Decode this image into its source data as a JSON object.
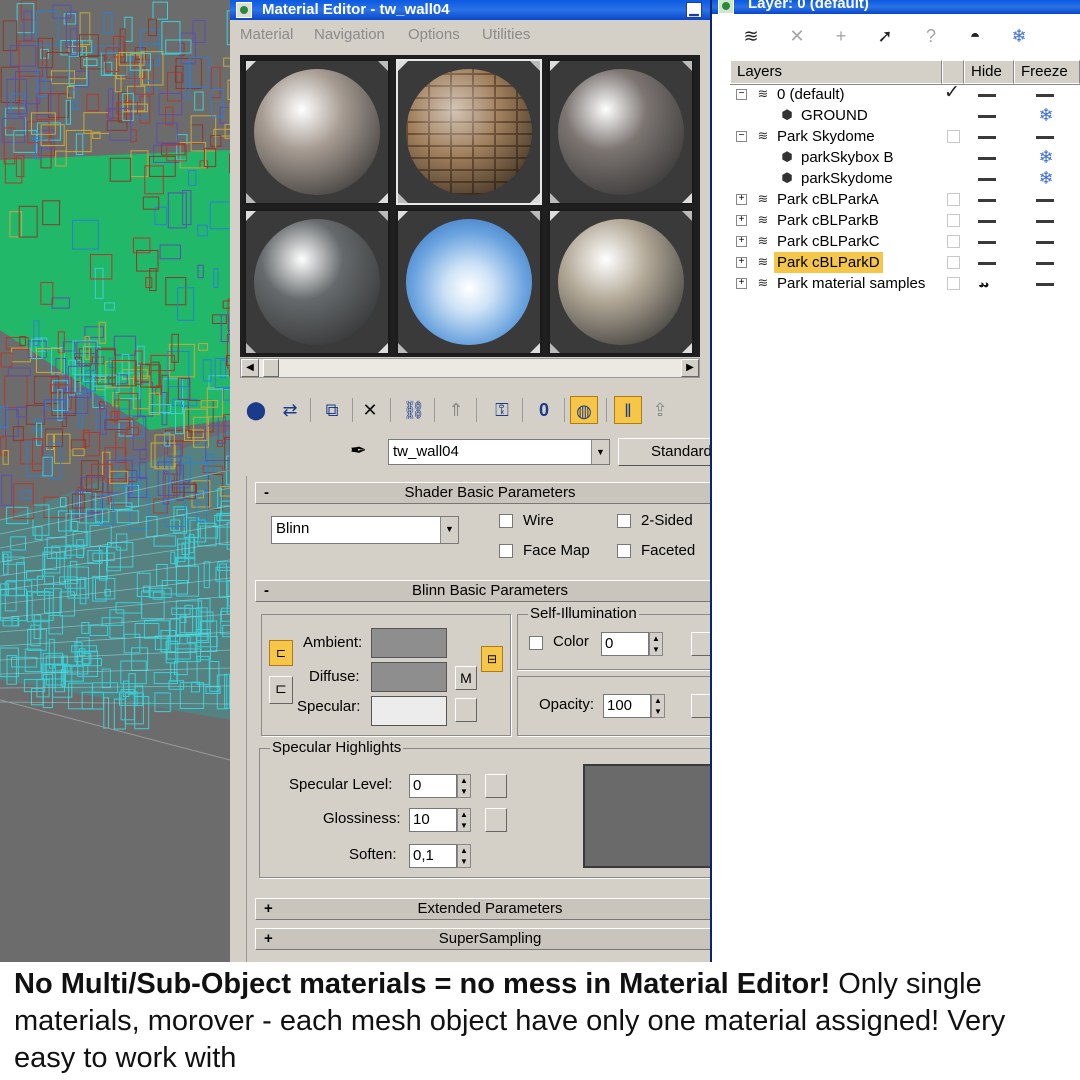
{
  "material_editor": {
    "title": "Material Editor - tw_wall04",
    "menu": [
      "Material",
      "Navigation",
      "Options",
      "Utilities"
    ],
    "material_name": "tw_wall04",
    "type_button": "Standard",
    "sample_slots": [
      {
        "name": "worn-concrete",
        "color": "#a79c93"
      },
      {
        "name": "brick",
        "color": "#a07f5c"
      },
      {
        "name": "dark-concrete",
        "color": "#7c7572"
      },
      {
        "name": "grey-stone",
        "color": "#666a6c"
      },
      {
        "name": "sky",
        "color": "#6aa3de"
      },
      {
        "name": "beige-plaster",
        "color": "#b4aa99"
      }
    ],
    "shader_rollout": {
      "title": "Shader Basic Parameters",
      "sign": "-",
      "shader": "Blinn",
      "wire": "Wire",
      "two_sided": "2-Sided",
      "face_map": "Face Map",
      "faceted": "Faceted"
    },
    "blinn_rollout": {
      "title": "Blinn Basic Parameters",
      "sign": "-",
      "ambient_label": "Ambient:",
      "diffuse_label": "Diffuse:",
      "specular_label": "Specular:",
      "map_button": "M",
      "self_illumination": "Self-Illumination",
      "color_label": "Color",
      "color_value": "0",
      "opacity_label": "Opacity:",
      "opacity_value": "100",
      "ambient_color": "#8e8e8e",
      "diffuse_color": "#8e8e8e",
      "specular_color": "#ececec"
    },
    "specular_highlights": {
      "title": "Specular Highlights",
      "level_label": "Specular Level:",
      "level_value": "0",
      "glossiness_label": "Glossiness:",
      "glossiness_value": "10",
      "soften_label": "Soften:",
      "soften_value": "0,1"
    },
    "extended_rollout": {
      "title": "Extended Parameters",
      "sign": "+"
    },
    "supersampling_rollout": {
      "title": "SuperSampling",
      "sign": "+"
    }
  },
  "layer_manager": {
    "title": "Layer: 0 (default)",
    "columns": {
      "layers": "Layers",
      "hide": "Hide",
      "freeze": "Freeze"
    },
    "rows": [
      {
        "name": "0 (default)",
        "kind": "layer",
        "expand": "−",
        "current": true,
        "hide": "—",
        "freeze": "—"
      },
      {
        "name": "GROUND",
        "kind": "object",
        "hide": "—",
        "freeze": "❄"
      },
      {
        "name": "Park Skydome",
        "kind": "layer",
        "expand": "−",
        "hide": "—",
        "freeze": "—"
      },
      {
        "name": "parkSkybox B",
        "kind": "object",
        "hide": "—",
        "freeze": "❄"
      },
      {
        "name": "parkSkydome",
        "kind": "object",
        "hide": "—",
        "freeze": "❄"
      },
      {
        "name": "Park cBLParkA",
        "kind": "layer",
        "expand": "+",
        "hide": "—",
        "freeze": "—"
      },
      {
        "name": "Park cBLParkB",
        "kind": "layer",
        "expand": "+",
        "hide": "—",
        "freeze": "—"
      },
      {
        "name": "Park cBLParkC",
        "kind": "layer",
        "expand": "+",
        "hide": "—",
        "freeze": "—"
      },
      {
        "name": "Park cBLParkD",
        "kind": "layer",
        "expand": "+",
        "selected": true,
        "hide": "—",
        "freeze": "—"
      },
      {
        "name": "Park material samples",
        "kind": "layer",
        "expand": "+",
        "hide": "hidden",
        "freeze": "—"
      }
    ]
  },
  "caption": {
    "bold": "No Multi/Sub-Object materials = no mess in Material Editor!",
    "text": " Only single materials, morover - each mesh object have only one material assigned! Very easy to work with"
  }
}
